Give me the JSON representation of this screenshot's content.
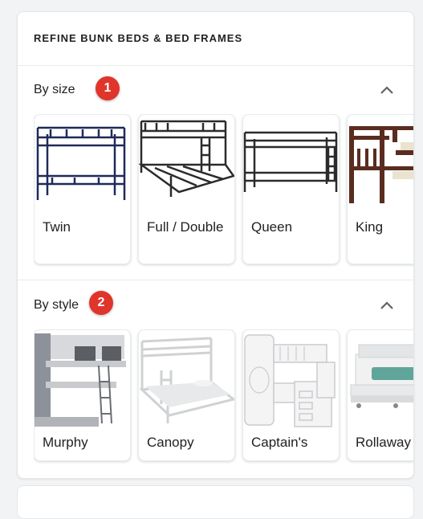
{
  "panel": {
    "heading": "REFINE BUNK BEDS & BED FRAMES"
  },
  "sections": [
    {
      "title": "By size",
      "badge": "1",
      "items": [
        {
          "label": "Twin"
        },
        {
          "label": "Full / Double"
        },
        {
          "label": "Queen"
        },
        {
          "label": "King"
        }
      ]
    },
    {
      "title": "By style",
      "badge": "2",
      "items": [
        {
          "label": "Murphy"
        },
        {
          "label": "Canopy"
        },
        {
          "label": "Captain's"
        },
        {
          "label": "Rollaway"
        }
      ]
    }
  ],
  "colors": {
    "badge": "#e0352b",
    "twin_frame": "#1f2a5a",
    "metal_frame": "#2b2b2b",
    "wood_frame": "#5a2c1f"
  },
  "icons": {
    "collapse": "chevron-up-icon"
  }
}
